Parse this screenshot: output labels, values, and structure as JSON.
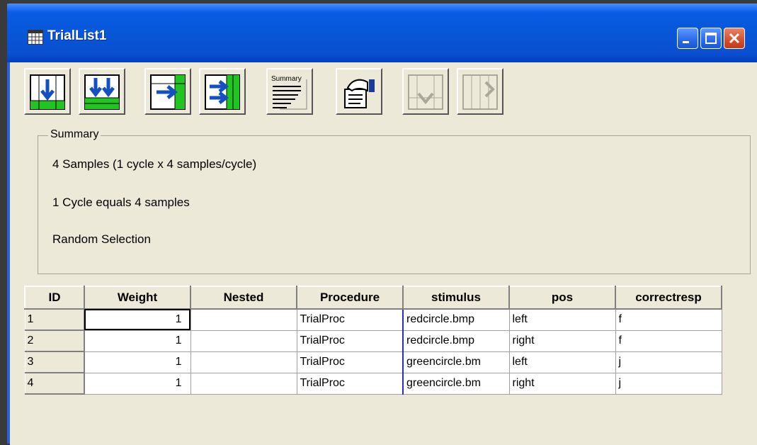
{
  "window": {
    "title": "TrialList1"
  },
  "toolbar": {
    "buttons": [
      {
        "name": "add-level",
        "icon": "down-arrow-grid-icon"
      },
      {
        "name": "add-multiple-levels",
        "icon": "double-down-arrow-grid-icon"
      },
      {
        "name": "add-attribute",
        "icon": "right-arrow-grid-icon"
      },
      {
        "name": "add-multiple-attributes",
        "icon": "double-right-arrow-grid-icon"
      },
      {
        "name": "summary",
        "icon": "summary-icon",
        "label": "Summary"
      },
      {
        "name": "properties",
        "icon": "properties-hand-icon"
      },
      {
        "name": "remove-levels",
        "icon": "remove-level-icon",
        "disabled": true
      },
      {
        "name": "remove-attributes",
        "icon": "remove-attribute-icon",
        "disabled": true
      }
    ]
  },
  "summary": {
    "title": "Summary",
    "lines": [
      "4 Samples (1 cycle x 4 samples/cycle)",
      "1 Cycle equals 4 samples",
      "Random Selection"
    ]
  },
  "grid": {
    "columns": [
      "ID",
      "Weight",
      "Nested",
      "Procedure",
      "stimulus",
      "pos",
      "correctresp"
    ],
    "rows": [
      {
        "id": "1",
        "weight": "1",
        "nested": "",
        "procedure": "TrialProc",
        "stimulus": "redcircle.bmp",
        "pos": "left",
        "correctresp": "f"
      },
      {
        "id": "2",
        "weight": "1",
        "nested": "",
        "procedure": "TrialProc",
        "stimulus": "redcircle.bmp",
        "pos": "right",
        "correctresp": "f"
      },
      {
        "id": "3",
        "weight": "1",
        "nested": "",
        "procedure": "TrialProc",
        "stimulus": "greencircle.bm",
        "pos": "left",
        "correctresp": "j"
      },
      {
        "id": "4",
        "weight": "1",
        "nested": "",
        "procedure": "TrialProc",
        "stimulus": "greencircle.bm",
        "pos": "right",
        "correctresp": "j"
      }
    ]
  },
  "colors": {
    "titlebar": "#0757d7",
    "face": "#ece9d8",
    "close": "#d4502b"
  }
}
